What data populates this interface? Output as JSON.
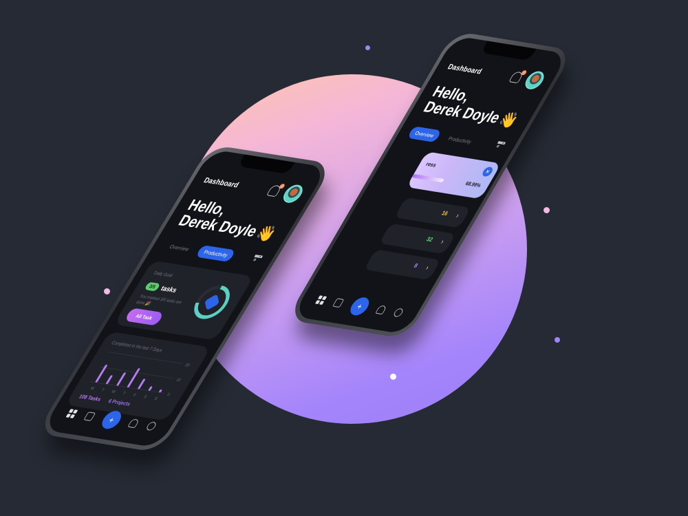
{
  "front_phone": {
    "header_title": "Dashboard",
    "greeting": "Hello,",
    "user_name": "Derek Doyle",
    "wave_emoji": "👋",
    "tabs": [
      {
        "label": "Overview",
        "active": false
      },
      {
        "label": "Productivity",
        "active": true
      }
    ],
    "daily_goal": {
      "label": "Daily Goal",
      "badge": "3/5",
      "unit": "tasks",
      "description": "You marked 3/5 tasks are done 🎉",
      "button_label": "All Task",
      "progress_fraction": 0.6
    },
    "weekly_chart": {
      "label": "Completed in the last 7 Days",
      "y_ticks": [
        "20",
        "10",
        "0"
      ],
      "days": [
        "M",
        "T",
        "W",
        "T",
        "F",
        "S",
        "S"
      ],
      "values": [
        12,
        6,
        9,
        13,
        7,
        3,
        2
      ],
      "y_max": 20
    },
    "stats": {
      "tasks": "108 Tasks",
      "projects": "6 Projects"
    },
    "fab_label": "+"
  },
  "back_phone": {
    "header_title": "Dashboard",
    "greeting": "Hello,",
    "user_name": "Derek Doyle",
    "wave_emoji": "👋",
    "tabs": [
      {
        "label": "Overview",
        "active": true
      },
      {
        "label": "Productivity",
        "active": false
      }
    ],
    "progress_card": {
      "title_fragment": "ress",
      "percent": "68.99%",
      "close_label": "✕"
    },
    "rows": [
      {
        "value": "16",
        "color": "#e8c44a"
      },
      {
        "value": "32",
        "color": "#6fd17a"
      },
      {
        "value": "8",
        "color": "#b48af5"
      }
    ]
  },
  "colors": {
    "accent": "#2c64ea",
    "purple": "#b77cf4",
    "green": "#5ecb6e",
    "teal": "#5dd0c4",
    "background": "#252a34"
  }
}
